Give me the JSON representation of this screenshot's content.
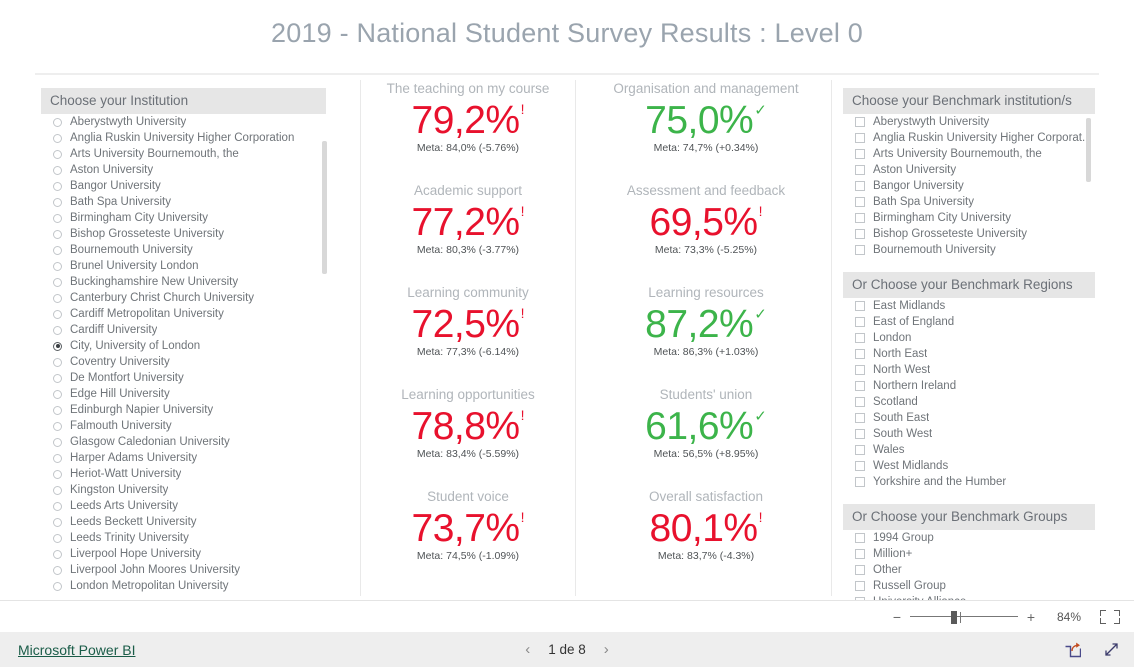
{
  "report": {
    "title": "2019 - National Student Survey Results : Level 0"
  },
  "institution_slicer": {
    "header": "Choose your Institution",
    "selected": "City, University of London",
    "items": [
      "Aberystwyth University",
      "Anglia Ruskin University Higher Corporation",
      "Arts University Bournemouth, the",
      "Aston University",
      "Bangor University",
      "Bath Spa University",
      "Birmingham City University",
      "Bishop Grosseteste University",
      "Bournemouth University",
      "Brunel University London",
      "Buckinghamshire New University",
      "Canterbury Christ Church University",
      "Cardiff Metropolitan University",
      "Cardiff University",
      "City, University of London",
      "Coventry University",
      "De Montfort University",
      "Edge Hill University",
      "Edinburgh Napier University",
      "Falmouth University",
      "Glasgow Caledonian University",
      "Harper Adams University",
      "Heriot-Watt University",
      "Kingston University",
      "Leeds Arts University",
      "Leeds Beckett University",
      "Leeds Trinity University",
      "Liverpool Hope University",
      "Liverpool John Moores University",
      "London Metropolitan University"
    ]
  },
  "benchmark_institution_slicer": {
    "header": "Choose your Benchmark institution/s",
    "items": [
      "Aberystwyth University",
      "Anglia Ruskin University Higher Corporat...",
      "Arts University Bournemouth, the",
      "Aston University",
      "Bangor University",
      "Bath Spa University",
      "Birmingham City University",
      "Bishop Grosseteste University",
      "Bournemouth University"
    ]
  },
  "benchmark_regions_slicer": {
    "header": "Or Choose your Benchmark Regions",
    "items": [
      "East Midlands",
      "East of England",
      "London",
      "North East",
      "North West",
      "Northern Ireland",
      "Scotland",
      "South East",
      "South West",
      "Wales",
      "West Midlands",
      "Yorkshire and the Humber"
    ]
  },
  "benchmark_groups_slicer": {
    "header": "Or Choose your Benchmark Groups",
    "items": [
      "1994 Group",
      "Million+",
      "Other",
      "Russell Group",
      "University Alliance"
    ]
  },
  "kpis": {
    "column_left": [
      {
        "title": "The teaching on my course",
        "value": "79,2%",
        "indicator": "!",
        "status": "negative",
        "meta": "Meta: 84,0% (-5.76%)"
      },
      {
        "title": "Academic support",
        "value": "77,2%",
        "indicator": "!",
        "status": "negative",
        "meta": "Meta: 80,3% (-3.77%)"
      },
      {
        "title": "Learning community",
        "value": "72,5%",
        "indicator": "!",
        "status": "negative",
        "meta": "Meta: 77,3% (-6.14%)"
      },
      {
        "title": "Learning opportunities",
        "value": "78,8%",
        "indicator": "!",
        "status": "negative",
        "meta": "Meta: 83,4% (-5.59%)"
      },
      {
        "title": "Student voice",
        "value": "73,7%",
        "indicator": "!",
        "status": "negative",
        "meta": "Meta: 74,5% (-1.09%)"
      }
    ],
    "column_right": [
      {
        "title": "Organisation and management",
        "value": "75,0%",
        "indicator": "✓",
        "status": "positive",
        "meta": "Meta: 74,7% (+0.34%)"
      },
      {
        "title": "Assessment and feedback",
        "value": "69,5%",
        "indicator": "!",
        "status": "negative",
        "meta": "Meta: 73,3% (-5.25%)"
      },
      {
        "title": "Learning resources",
        "value": "87,2%",
        "indicator": "✓",
        "status": "positive",
        "meta": "Meta: 86,3% (+1.03%)"
      },
      {
        "title": "Students' union",
        "value": "61,6%",
        "indicator": "✓",
        "status": "positive",
        "meta": "Meta: 56,5% (+8.95%)"
      },
      {
        "title": "Overall satisfaction",
        "value": "80,1%",
        "indicator": "!",
        "status": "negative",
        "meta": "Meta: 83,7% (-4.3%)"
      }
    ]
  },
  "zoom_bar": {
    "minus": "−",
    "plus": "+",
    "percent": "84%"
  },
  "footer": {
    "brand": "Microsoft Power BI",
    "prev": "‹",
    "next": "›",
    "page_label": "1 de 8"
  },
  "colors": {
    "negative": "#e8112d",
    "positive": "#3cb44a",
    "title": "#9aa4ae",
    "slicer_header_bg": "#e6e6e6",
    "brand_link": "#1a5c48"
  }
}
